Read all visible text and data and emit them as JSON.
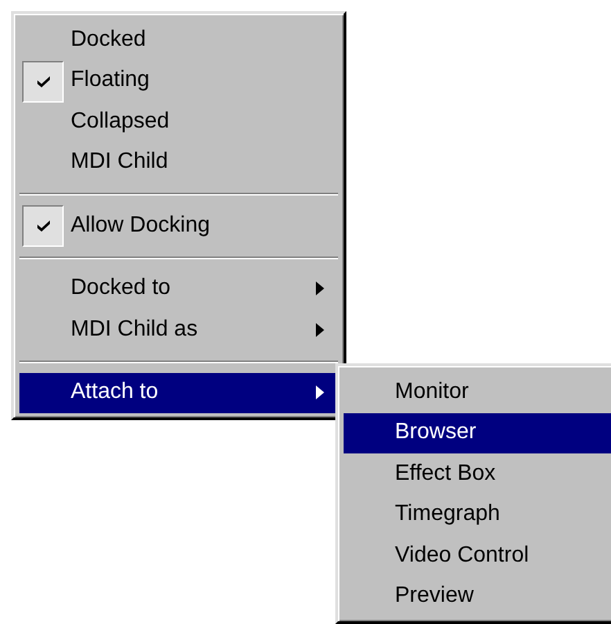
{
  "menu": {
    "items": [
      {
        "kind": "item",
        "label": "Docked",
        "checked": false,
        "selected": false
      },
      {
        "kind": "item",
        "label": "Floating",
        "checked": true,
        "selected": false
      },
      {
        "kind": "item",
        "label": "Collapsed",
        "checked": false,
        "selected": false
      },
      {
        "kind": "item",
        "label": "MDI Child",
        "checked": false,
        "selected": false
      },
      {
        "kind": "separator"
      },
      {
        "kind": "item",
        "label": "Allow Docking",
        "checked": true,
        "selected": false
      },
      {
        "kind": "separator"
      },
      {
        "kind": "submenu",
        "label": "Docked to",
        "checked": false,
        "selected": false
      },
      {
        "kind": "submenu",
        "label": "MDI Child as",
        "checked": false,
        "selected": false
      },
      {
        "kind": "separator"
      },
      {
        "kind": "submenu",
        "label": "Attach to",
        "checked": false,
        "selected": true
      }
    ]
  },
  "submenu": {
    "items": [
      {
        "kind": "item",
        "label": "Monitor",
        "selected": false
      },
      {
        "kind": "item",
        "label": "Browser",
        "selected": true
      },
      {
        "kind": "item",
        "label": "Effect Box",
        "selected": false
      },
      {
        "kind": "item",
        "label": "Timegraph",
        "selected": false
      },
      {
        "kind": "item",
        "label": "Video Control",
        "selected": false
      },
      {
        "kind": "item",
        "label": "Preview",
        "selected": false
      }
    ]
  }
}
